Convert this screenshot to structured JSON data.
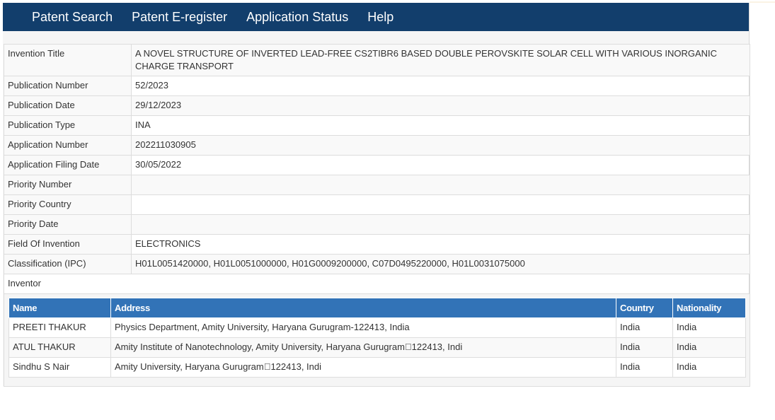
{
  "nav": {
    "items": [
      "Patent Search",
      "Patent E-register",
      "Application Status",
      "Help"
    ]
  },
  "details": {
    "rows": [
      {
        "label": "Invention Title",
        "value": "A NOVEL STRUCTURE OF INVERTED LEAD-FREE CS2TIBR6 BASED DOUBLE PEROVSKITE SOLAR CELL WITH VARIOUS INORGANIC CHARGE TRANSPORT"
      },
      {
        "label": "Publication Number",
        "value": "52/2023"
      },
      {
        "label": "Publication Date",
        "value": "29/12/2023"
      },
      {
        "label": "Publication Type",
        "value": "INA"
      },
      {
        "label": "Application Number",
        "value": "202211030905"
      },
      {
        "label": "Application Filing Date",
        "value": "30/05/2022"
      },
      {
        "label": "Priority Number",
        "value": ""
      },
      {
        "label": "Priority Country",
        "value": ""
      },
      {
        "label": "Priority Date",
        "value": ""
      },
      {
        "label": "Field Of Invention",
        "value": "ELECTRONICS"
      },
      {
        "label": "Classification (IPC)",
        "value": "H01L0051420000, H01L0051000000, H01G0009200000, C07D0495220000, H01L0031075000"
      }
    ],
    "inventor_label": "Inventor"
  },
  "inventors": {
    "headers": [
      "Name",
      "Address",
      "Country",
      "Nationality"
    ],
    "rows": [
      {
        "name": "PREETI THAKUR",
        "address": "Physics Department, Amity University, Haryana Gurugram-122413, India",
        "country": "India",
        "nationality": "India"
      },
      {
        "name": "ATUL THAKUR",
        "address": "Amity Institute of Nanotechnology, Amity University, Haryana Gurugram\u0000122413, Indi",
        "country": "India",
        "nationality": "India"
      },
      {
        "name": "Sindhu S Nair",
        "address": "Amity University, Haryana Gurugram\u0000122413, Indi",
        "country": "India",
        "nationality": "India"
      }
    ]
  },
  "colors": {
    "nav_bg": "#123e6c",
    "table_header_bg": "#3273b7"
  }
}
